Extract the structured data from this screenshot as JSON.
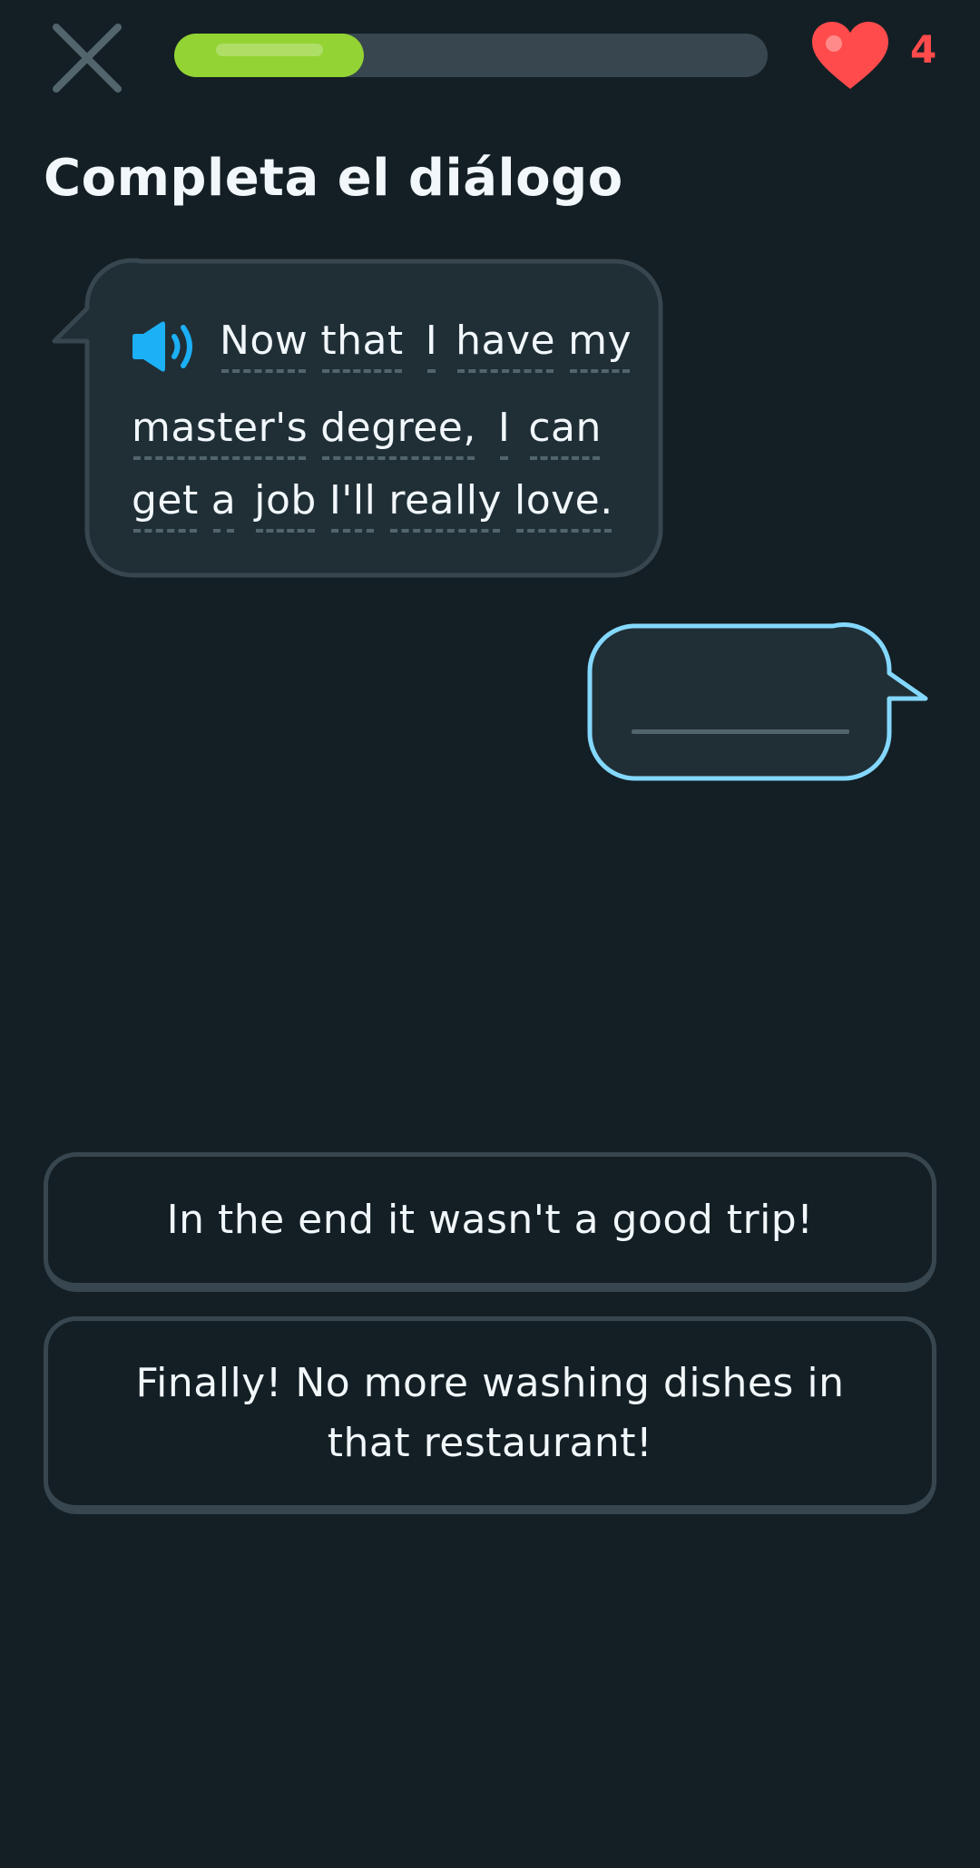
{
  "header": {
    "close_icon": "close-icon",
    "progress": 0.32,
    "progress_color": "#93d333",
    "hearts_icon": "heart-icon",
    "hearts_count": "4",
    "hearts_color": "#ff4b4b"
  },
  "title": "Completa el diálogo",
  "prompt": {
    "speaker_icon": "speaker-icon",
    "lines": [
      [
        "Now",
        "that",
        "I",
        "have",
        "my"
      ],
      [
        "master's",
        "degree,",
        "I",
        "can"
      ],
      [
        "get",
        "a",
        "job",
        "I'll",
        "really",
        "love."
      ]
    ]
  },
  "answer": {
    "blank": "empty-answer-slot",
    "border_color": "#84d8ff"
  },
  "choices": [
    "In the end it wasn't a good trip!",
    "Finally! No more washing dishes in that restaurant!"
  ]
}
